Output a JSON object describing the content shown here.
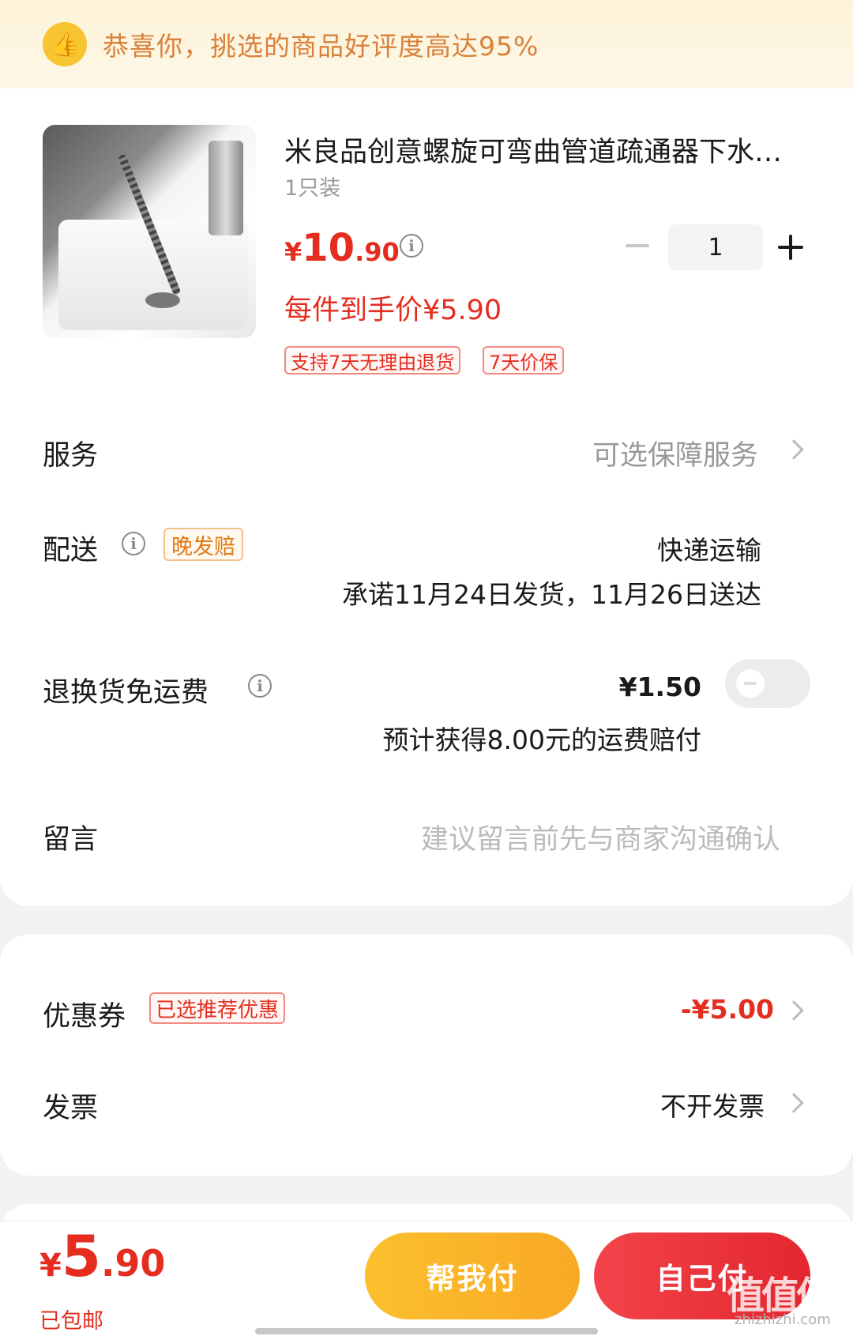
{
  "banner": {
    "text": "恭喜你，挑选的商品好评度高达95%",
    "icon": "thumbs-up-icon"
  },
  "product": {
    "title": "米良品创意螺旋可弯曲管道疏通器下水道头发清理神器",
    "spec": "1只装",
    "price_yen": "¥",
    "price_int": "10",
    "price_dec": ".90",
    "deal_price": "每件到手价¥5.90",
    "quantity": "1",
    "tags": [
      "支持7天无理由退货",
      "7天价保"
    ]
  },
  "rows": {
    "service": {
      "label": "服务",
      "value": "可选保障服务"
    },
    "delivery": {
      "label": "配送",
      "tag": "晚发赔",
      "method": "快递运输",
      "promise": "承诺11月24日发货，11月26日送达"
    },
    "return_shipping": {
      "label": "退换货免运费",
      "price": "¥1.50",
      "desc": "预计获得8.00元的运费赔付",
      "toggle_on": false
    },
    "message": {
      "label": "留言",
      "placeholder": "建议留言前先与商家沟通确认"
    }
  },
  "coupon": {
    "label": "优惠券",
    "tag": "已选推荐优惠",
    "value": "-¥5.00"
  },
  "invoice": {
    "label": "发票",
    "value": "不开发票"
  },
  "footer": {
    "total_yen": "¥",
    "total_int": "5",
    "total_dec": ".90",
    "shipping": "已包邮",
    "help_pay": "帮我付",
    "self_pay": "自己付"
  },
  "watermark": {
    "main": "值值值",
    "sub": "zhizhizhi.com"
  },
  "colors": {
    "accent_red": "#e52d1f",
    "banner_text": "#d9813a",
    "help_btn": "#f9a825",
    "self_btn": "#e3262f"
  }
}
